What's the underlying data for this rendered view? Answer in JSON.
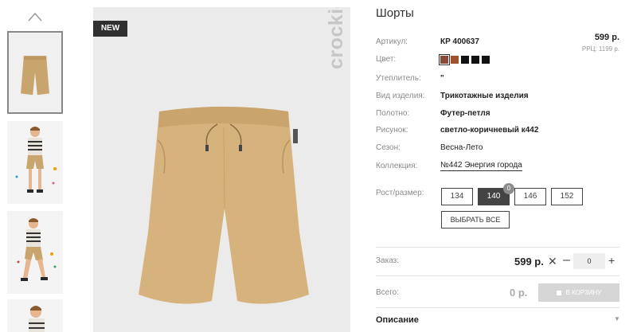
{
  "badge": "NEW",
  "brand": "crockid",
  "product": {
    "title": "Шорты",
    "price": "599 р.",
    "rrc": "РРЦ: 1199 р."
  },
  "attributes": [
    {
      "label": "Артикул:",
      "value": "КР 400637"
    },
    {
      "label": "Цвет:",
      "value": ""
    },
    {
      "label": "Утеплитель:",
      "value": "\""
    },
    {
      "label": "Вид изделия:",
      "value": "Трикотажные изделия"
    },
    {
      "label": "Полотно:",
      "value": "Футер-петля"
    },
    {
      "label": "Рисунок:",
      "value": "светло-коричневый к442"
    },
    {
      "label": "Сезон:",
      "value": "Весна-Лето"
    },
    {
      "label": "Коллекция:",
      "value": "№442 Энергия города"
    }
  ],
  "colors": [
    "#8a4a36",
    "#a0522d",
    "#111111",
    "#111111",
    "#111111"
  ],
  "sizes": {
    "label": "Рост/размер:",
    "options": [
      "134",
      "140",
      "146",
      "152"
    ],
    "active": "140",
    "count": "0",
    "select_all": "ВЫБРАТЬ ВСЕ"
  },
  "order": {
    "label": "Заказ:",
    "price": "599 р.",
    "quantity": "0"
  },
  "total": {
    "label": "Всего:",
    "value": "0 р.",
    "cart_button": "В КОРЗИНУ"
  },
  "description": {
    "label": "Описание"
  },
  "icons": {
    "up": "chevron-up-icon",
    "remove": "close-icon",
    "cart": "cart-icon",
    "expand": "chevron-down-icon"
  }
}
